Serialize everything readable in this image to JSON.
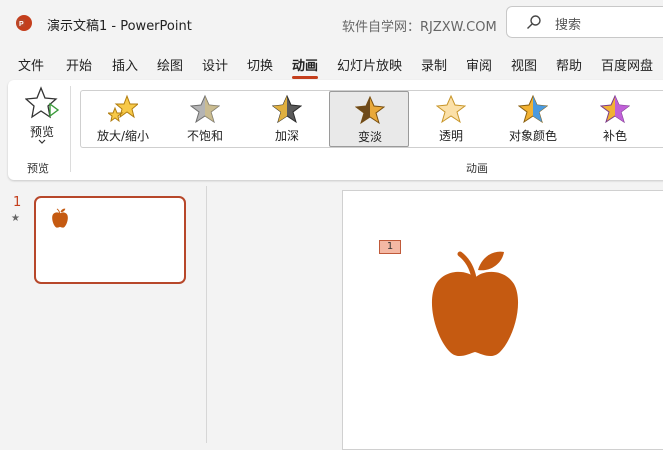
{
  "titlebar": {
    "doc_title": "演示文稿1  -  PowerPoint",
    "watermark": "软件自学网：RJZXW.COM",
    "search_label": "搜索",
    "app_logo_icon": "powerpoint-logo-icon",
    "accent": "#c43e1c"
  },
  "menu": {
    "tabs": [
      {
        "label": "文件"
      },
      {
        "label": "开始"
      },
      {
        "label": "插入"
      },
      {
        "label": "绘图"
      },
      {
        "label": "设计"
      },
      {
        "label": "切换"
      },
      {
        "label": "动画"
      },
      {
        "label": "幻灯片放映"
      },
      {
        "label": "录制"
      },
      {
        "label": "审阅"
      },
      {
        "label": "视图"
      },
      {
        "label": "帮助"
      },
      {
        "label": "百度网盘"
      }
    ],
    "active_tab": "动画"
  },
  "ribbon": {
    "preview": {
      "label": "预览",
      "group_label": "预览"
    },
    "animation_group_label": "动画",
    "effects": [
      {
        "label": "放大/缩小",
        "icon": "grow-shrink-star-icon",
        "color": "#f2b233"
      },
      {
        "label": "不饱和",
        "icon": "desaturate-star-icon",
        "color": "#a8a8a8"
      },
      {
        "label": "加深",
        "icon": "darken-star-icon",
        "color": "#555555"
      },
      {
        "label": "变淡",
        "icon": "lighten-star-icon",
        "color": "#d89a2a"
      },
      {
        "label": "透明",
        "icon": "transparency-star-icon",
        "color": "#f7d08a"
      },
      {
        "label": "对象颜色",
        "icon": "object-color-star-icon",
        "color": "#3a86d4"
      },
      {
        "label": "补色",
        "icon": "complementary-color-star-icon",
        "color": "#b04dc8"
      }
    ],
    "selected_effect": "变淡"
  },
  "slides": {
    "number": "1",
    "star": "★"
  },
  "canvas": {
    "animation_tag": "1",
    "apple_color": "#c55a11"
  }
}
